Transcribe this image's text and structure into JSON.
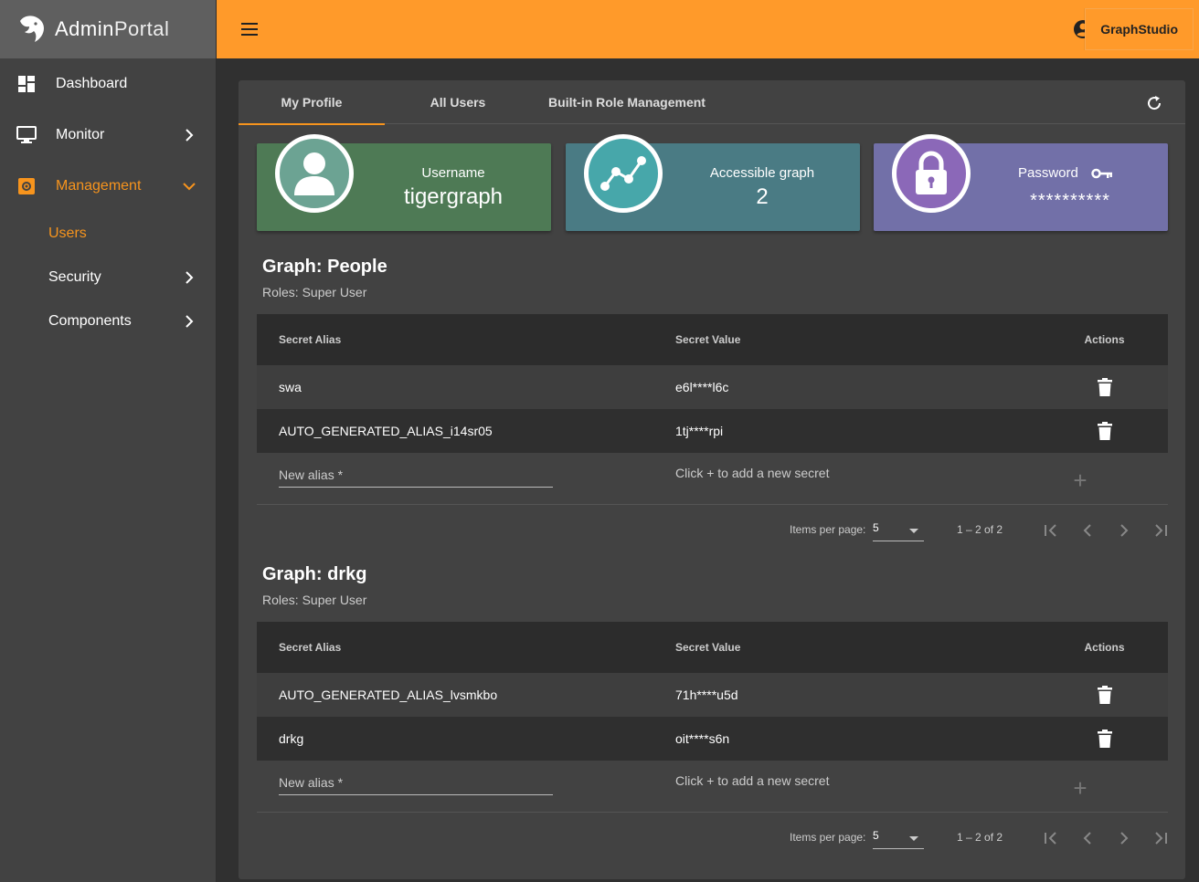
{
  "app": {
    "logo_main": "Admin",
    "logo_thin": "Portal"
  },
  "topbar": {
    "graphstudio_label": "GraphStudio"
  },
  "sidebar": {
    "items": [
      {
        "label": "Dashboard"
      },
      {
        "label": "Monitor"
      },
      {
        "label": "Management"
      }
    ],
    "sub_items": [
      {
        "label": "Users"
      },
      {
        "label": "Security"
      },
      {
        "label": "Components"
      }
    ]
  },
  "tabs": [
    {
      "label": "My Profile"
    },
    {
      "label": "All Users"
    },
    {
      "label": "Built-in Role Management"
    }
  ],
  "tiles": {
    "username_label": "Username",
    "username_value": "tigergraph",
    "graph_label": "Accessible graph",
    "graph_value": "2",
    "password_label": "Password",
    "password_value": "**********"
  },
  "table_headers": {
    "alias": "Secret Alias",
    "value": "Secret Value",
    "actions": "Actions"
  },
  "graphs": [
    {
      "title": "Graph: People",
      "roles": "Roles: Super User",
      "rows": [
        {
          "alias": "swa",
          "value": "e6l****l6c"
        },
        {
          "alias": "AUTO_GENERATED_ALIAS_i14sr05",
          "value": "1tj****rpi"
        }
      ],
      "new_alias_placeholder": "New alias *",
      "new_hint": "Click + to add a new secret",
      "items_per_page_label": "Items per page:",
      "page_size": "5",
      "range": "1 – 2 of 2"
    },
    {
      "title": "Graph: drkg",
      "roles": "Roles: Super User",
      "rows": [
        {
          "alias": "AUTO_GENERATED_ALIAS_lvsmkbo",
          "value": "71h****u5d"
        },
        {
          "alias": "drkg",
          "value": "oit****s6n"
        }
      ],
      "new_alias_placeholder": "New alias *",
      "new_hint": "Click + to add a new secret",
      "items_per_page_label": "Items per page:",
      "page_size": "5",
      "range": "1 – 2 of 2"
    }
  ],
  "colors": {
    "accent": "#f7941d",
    "topbar": "#ff9a2a",
    "tile_user": "#4e7a55",
    "tile_graph": "#4a7b84",
    "tile_password": "#7270a8"
  }
}
